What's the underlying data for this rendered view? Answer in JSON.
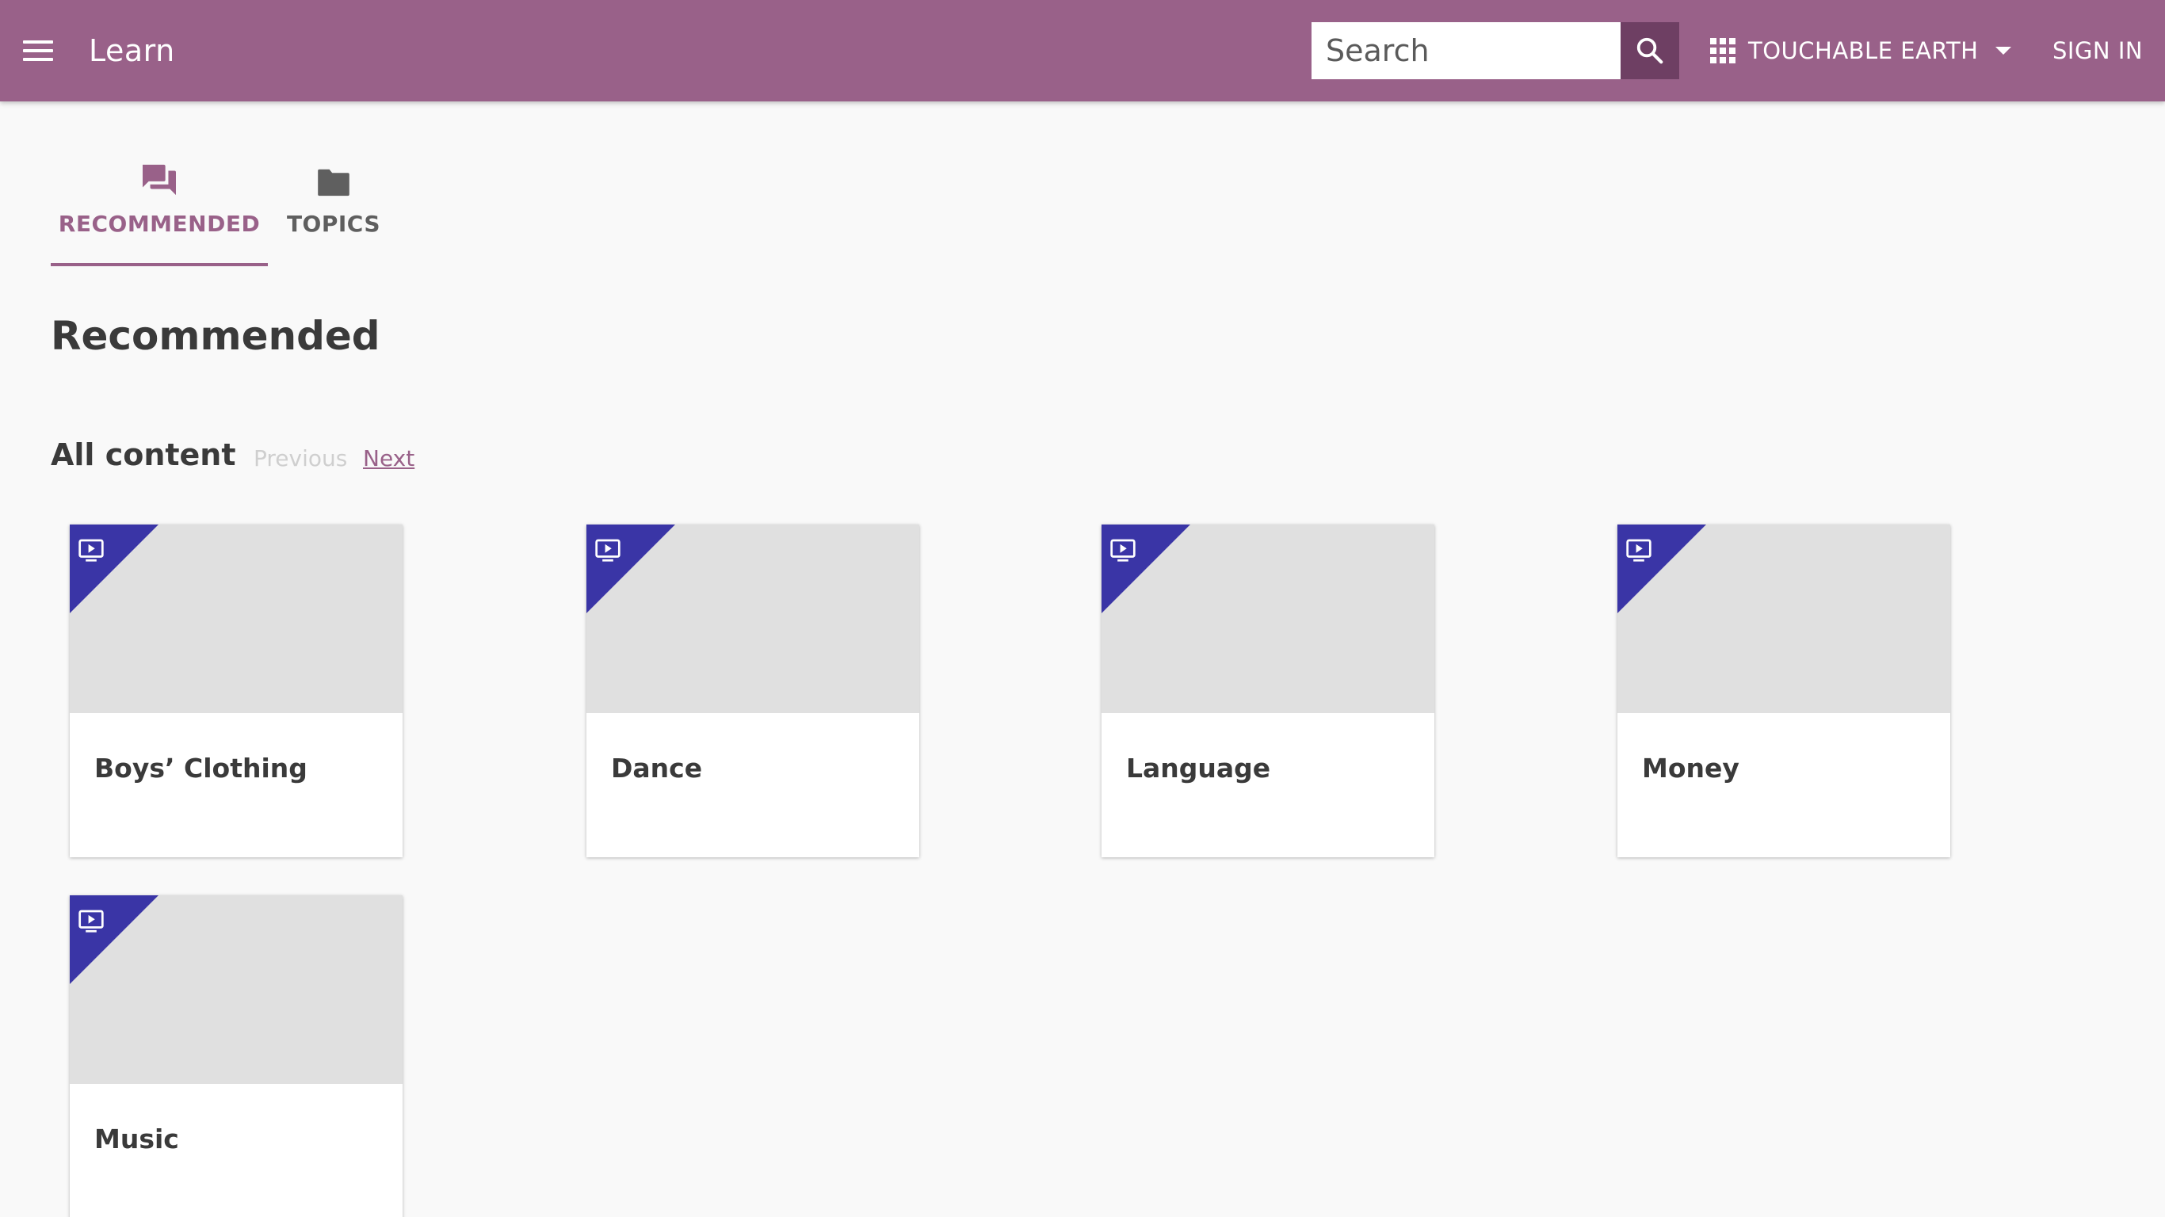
{
  "header": {
    "app_title": "Learn",
    "search_placeholder": "Search",
    "channel_label": "TOUCHABLE EARTH",
    "signin_label": "SIGN IN",
    "bar_color": "#996189"
  },
  "tabs": [
    {
      "label": "RECOMMENDED",
      "icon": "forum-icon",
      "active": true
    },
    {
      "label": "TOPICS",
      "icon": "folder-icon",
      "active": false
    }
  ],
  "main": {
    "heading": "Recommended",
    "section_heading": "All content",
    "pager": {
      "previous": "Previous",
      "next": "Next",
      "previous_disabled": true
    },
    "cards": [
      {
        "title": "Boys’ Clothing",
        "kind": "video-icon"
      },
      {
        "title": "Dance",
        "kind": "video-icon"
      },
      {
        "title": "Language",
        "kind": "video-icon"
      },
      {
        "title": "Money",
        "kind": "video-icon"
      },
      {
        "title": "Music",
        "kind": "video-icon"
      }
    ]
  },
  "colors": {
    "accent": "#996189",
    "badge": "#3a35a6",
    "thumbnail": "#e0e0e0"
  }
}
